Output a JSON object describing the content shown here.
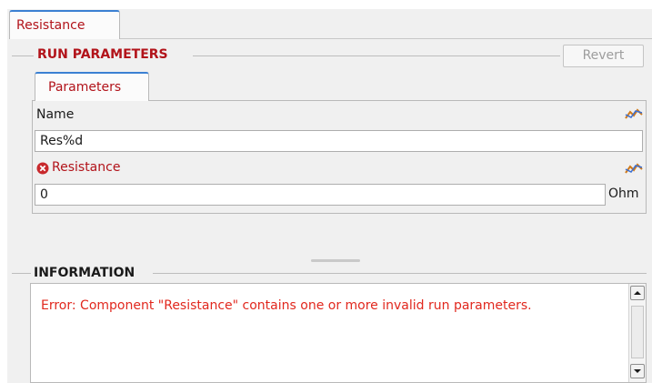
{
  "tab": {
    "label": "Resistance"
  },
  "run_parameters": {
    "title": "RUN PARAMETERS",
    "revert_label": "Revert",
    "tab_label": "Parameters",
    "fields": [
      {
        "label": "Name",
        "value": "Res%d",
        "error": false
      },
      {
        "label": "Resistance",
        "value": "0",
        "unit": "Ohm",
        "error": true
      }
    ]
  },
  "information": {
    "title": "INFORMATION",
    "message": "Error: Component \"Resistance\" contains one or more invalid run parameters."
  },
  "icons": [
    "chart-icon",
    "error-icon",
    "scroll-up-arrow-icon",
    "scroll-down-arrow-icon"
  ],
  "colors": {
    "accent_red": "#b2131a",
    "error_text": "#e1281e",
    "tab_highlight": "#3b80d2"
  }
}
